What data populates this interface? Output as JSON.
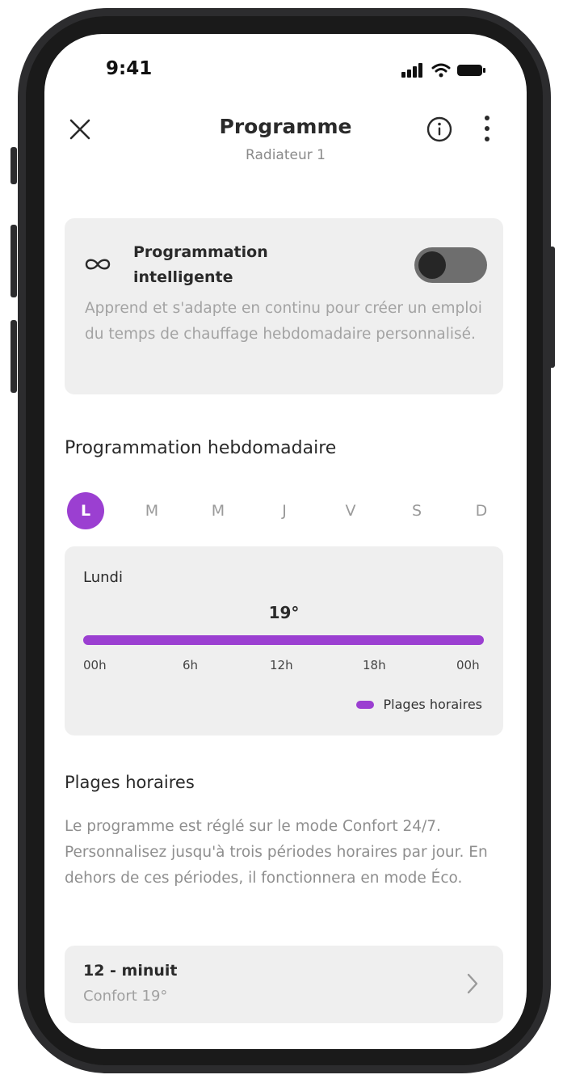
{
  "status_bar": {
    "time": "9:41"
  },
  "header": {
    "title": "Programme",
    "subtitle": "Radiateur 1"
  },
  "smart": {
    "title_line1": "Programmation",
    "title_line2": "intelligente",
    "enabled": false,
    "description": "Apprend et s'adapte en continu pour créer un emploi du temps de chauffage hebdomadaire personnalisé."
  },
  "weekly": {
    "title": "Programmation hebdomadaire",
    "days": [
      "L",
      "M",
      "M",
      "J",
      "V",
      "S",
      "D"
    ],
    "selected_day_index": 0,
    "day_card": {
      "day_name": "Lundi",
      "temperature": "19°",
      "ticks": [
        "00h",
        "6h",
        "12h",
        "18h",
        "00h"
      ],
      "legend": "Plages horaires"
    }
  },
  "plages": {
    "title": "Plages horaires",
    "description": "Le programme est réglé sur le mode Confort 24/7. Personnalisez jusqu'à trois périodes horaires par jour. En dehors de ces périodes, il fonctionnera en mode Éco.",
    "slots": [
      {
        "title": "12 - minuit",
        "subtitle": "Confort 19°"
      }
    ]
  },
  "colors": {
    "accent": "#9b3fd1",
    "card_bg": "#efefef",
    "toggle_off": "#6e6e6e"
  },
  "icons": {
    "close": "close-icon",
    "info": "info-icon",
    "more": "more-vertical-icon",
    "infinity": "infinity-icon",
    "chevron": "chevron-right-icon"
  }
}
